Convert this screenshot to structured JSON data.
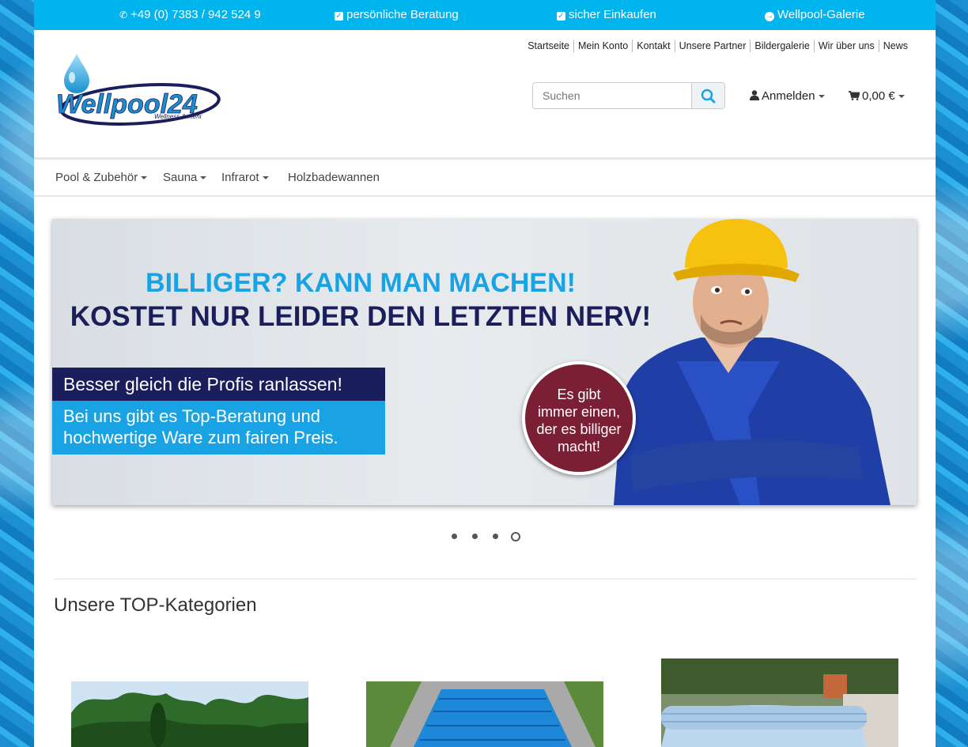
{
  "topbar": {
    "phone": "+49 (0) 7383 / 942 524 9",
    "consulting": "persönliche Beratung",
    "secure": "sicher Einkaufen",
    "gallery": "Wellpool-Galerie"
  },
  "top_links": [
    "Startseite",
    "Mein Konto",
    "Kontakt",
    "Unsere Partner",
    "Bildergalerie",
    "Wir über uns",
    "News"
  ],
  "logo": {
    "brand": "Wellpool24",
    "tagline": "Wellness & mehr"
  },
  "search": {
    "placeholder": "Suchen"
  },
  "account": {
    "login_label": "Anmelden",
    "cart_total": "0,00 €"
  },
  "nav": [
    "Pool & Zubehör",
    "Sauna",
    "Infrarot",
    "Holzbadewannen"
  ],
  "banner": {
    "headline1": "BILLIGER? KANN MAN MACHEN!",
    "headline2": "KOSTET NUR LEIDER DEN LETZTEN NERV!",
    "box_dark": "Besser gleich die Profis ranlassen!",
    "box_light_line1": "Bei uns gibt es Top-Beratung und",
    "box_light_line2": "hochwertige Ware zum fairen Preis.",
    "badge_lines": [
      "Es gibt",
      "immer einen,",
      "der es billiger",
      "macht!"
    ]
  },
  "carousel": {
    "slide_count": 4,
    "active_index": 3
  },
  "section": {
    "title": "Unsere TOP-Kategorien"
  },
  "colors": {
    "accent": "#00b4ee",
    "navy": "#1b1e5c",
    "badge": "#7b1f34"
  }
}
